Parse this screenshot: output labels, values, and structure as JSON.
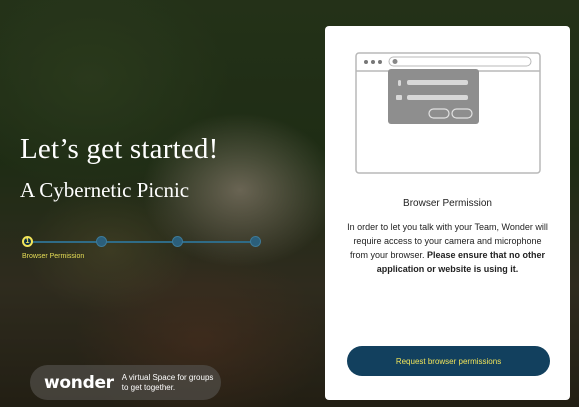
{
  "hero": {
    "headline": "Let’s get started!",
    "subtitle": "A Cybernetic Picnic"
  },
  "stepper": {
    "steps": [
      {
        "number": "1",
        "label": "Browser Permission",
        "active": true
      },
      {
        "number": "2",
        "label": "",
        "active": false
      },
      {
        "number": "3",
        "label": "",
        "active": false
      },
      {
        "number": "4",
        "label": "",
        "active": false
      }
    ]
  },
  "brand": {
    "logo": "wonder",
    "tagline": "A virtual Space for groups to get together."
  },
  "permission_panel": {
    "title": "Browser Permission",
    "body_text": "In order to let you talk with your Team, Wonder will require access to your camera and microphone from your browser.",
    "body_emphasis": "Please ensure that no other application or website is using it.",
    "button_label": "Request browser permissions"
  },
  "colors": {
    "accent_yellow": "#efe35a",
    "button_navy": "#12405e",
    "stepper_blue": "#2f6b86"
  }
}
